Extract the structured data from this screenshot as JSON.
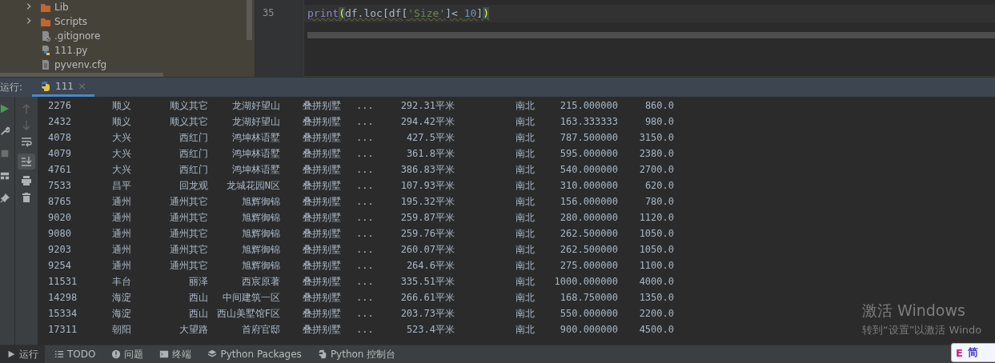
{
  "project_tree": {
    "items": [
      {
        "label": "Lib",
        "kind": "folder",
        "expanded": false
      },
      {
        "label": "Scripts",
        "kind": "folder",
        "expanded": false
      },
      {
        "label": ".gitignore",
        "kind": "ignore"
      },
      {
        "label": "111.py",
        "kind": "python"
      },
      {
        "label": "pyvenv.cfg",
        "kind": "text"
      }
    ]
  },
  "editor": {
    "line_number": "35",
    "code": [
      {
        "text": "print",
        "kind": "builtin"
      },
      {
        "text": "(",
        "kind": "brace"
      },
      {
        "text": "df.loc[df[",
        "kind": "plain"
      },
      {
        "text": "'Size'",
        "kind": "string"
      },
      {
        "text": "]< ",
        "kind": "plain"
      },
      {
        "text": "10",
        "kind": "number"
      },
      {
        "text": "]",
        "kind": "plain"
      },
      {
        "text": ")",
        "kind": "brace"
      }
    ]
  },
  "run_panel": {
    "label": "运行:",
    "tabs": [
      {
        "label": "111",
        "selected": true,
        "close": "×"
      }
    ]
  },
  "console": {
    "rows": [
      [
        "2276",
        "顺义",
        "顺义其它",
        "龙湖好望山",
        "叠拼别墅",
        "...",
        "292.31平米",
        "南北",
        "215.000000",
        "860.0"
      ],
      [
        "2432",
        "顺义",
        "顺义其它",
        "龙湖好望山",
        "叠拼别墅",
        "...",
        "294.42平米",
        "南北",
        "163.333333",
        "980.0"
      ],
      [
        "4078",
        "大兴",
        "西红门",
        "鸿坤林语墅",
        "叠拼别墅",
        "...",
        "427.5平米",
        "南北",
        "787.500000",
        "3150.0"
      ],
      [
        "4079",
        "大兴",
        "西红门",
        "鸿坤林语墅",
        "叠拼别墅",
        "...",
        "361.8平米",
        "南北",
        "595.000000",
        "2380.0"
      ],
      [
        "4761",
        "大兴",
        "西红门",
        "鸿坤林语墅",
        "叠拼别墅",
        "...",
        "386.83平米",
        "南北",
        "540.000000",
        "2700.0"
      ],
      [
        "7533",
        "昌平",
        "回龙观",
        "龙城花园N区",
        "叠拼别墅",
        "...",
        "107.93平米",
        "南北",
        "310.000000",
        "620.0"
      ],
      [
        "8765",
        "通州",
        "通州其它",
        "旭辉御锦",
        "叠拼别墅",
        "...",
        "195.32平米",
        "南北",
        "156.000000",
        "780.0"
      ],
      [
        "9020",
        "通州",
        "通州其它",
        "旭辉御锦",
        "叠拼别墅",
        "...",
        "259.87平米",
        "南北",
        "280.000000",
        "1120.0"
      ],
      [
        "9080",
        "通州",
        "通州其它",
        "旭辉御锦",
        "叠拼别墅",
        "...",
        "259.76平米",
        "南北",
        "262.500000",
        "1050.0"
      ],
      [
        "9203",
        "通州",
        "通州其它",
        "旭辉御锦",
        "叠拼别墅",
        "...",
        "260.07平米",
        "南北",
        "262.500000",
        "1050.0"
      ],
      [
        "9254",
        "通州",
        "通州其它",
        "旭辉御锦",
        "叠拼别墅",
        "...",
        "264.6平米",
        "南北",
        "275.000000",
        "1100.0"
      ],
      [
        "11531",
        "丰台",
        "丽泽",
        "西宸原著",
        "叠拼别墅",
        "...",
        "335.51平米",
        "南北",
        "1000.000000",
        "4000.0"
      ],
      [
        "14298",
        "海淀",
        "西山",
        "中间建筑一区",
        "叠拼别墅",
        "...",
        "266.61平米",
        "南北",
        "168.750000",
        "1350.0"
      ],
      [
        "15334",
        "海淀",
        "西山",
        "西山美墅馆F区",
        "叠拼别墅",
        "...",
        "203.73平米",
        "南北",
        "550.000000",
        "2200.0"
      ],
      [
        "17311",
        "朝阳",
        "大望路",
        "首府官邸",
        "叠拼别墅",
        "...",
        "523.4平米",
        "南北",
        "900.000000",
        "4500.0"
      ]
    ]
  },
  "bottom_bar": {
    "items": [
      {
        "label": "运行",
        "kind": "run",
        "selected": true
      },
      {
        "label": "TODO",
        "kind": "list",
        "selected": false
      },
      {
        "label": "问题",
        "kind": "info",
        "selected": false
      },
      {
        "label": "终端",
        "kind": "terminal",
        "selected": false
      },
      {
        "label": "Python Packages",
        "kind": "package",
        "selected": false
      },
      {
        "label": "Python 控制台",
        "kind": "python",
        "selected": false
      }
    ]
  },
  "os_overlay": {
    "title": "激活 Windows",
    "subtitle": "转到“设置”以激活 Windo",
    "ime": [
      "E",
      "简"
    ]
  }
}
